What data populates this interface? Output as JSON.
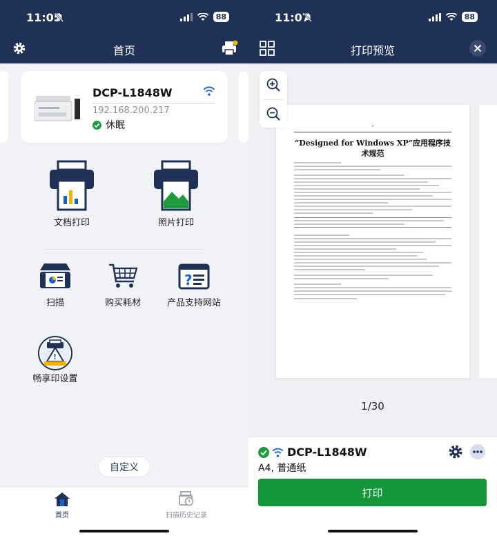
{
  "left": {
    "status": {
      "time": "11:05",
      "battery": "88"
    },
    "header": {
      "title": "首页"
    },
    "printer": {
      "name": "DCP-L1848W",
      "ip": "192.168.200.217",
      "status": "休眠"
    },
    "functions": {
      "doc_print": "文档打印",
      "photo_print": "照片打印",
      "scan": "扫描",
      "buy_supplies": "购买耗材",
      "support_site": "产品支持网站",
      "share_settings": "畅享印设置"
    },
    "customize": "自定义",
    "tabs": {
      "home": "首页",
      "history": "扫描历史记录"
    }
  },
  "right": {
    "status": {
      "time": "11:07",
      "battery": "88"
    },
    "header": {
      "title": "打印预览"
    },
    "document": {
      "page_number": "1",
      "title": "“Designed for Windows XP”应用程序技术规范"
    },
    "page_count": "1/30",
    "printer": {
      "name": "DCP-L1848W",
      "paper": "A4, 普通纸"
    },
    "print_button": "打印"
  },
  "colors": {
    "navy": "#1f3157",
    "accent_green": "#14963a",
    "status_green": "#1e9b3d",
    "link_blue": "#1a5fd0"
  }
}
